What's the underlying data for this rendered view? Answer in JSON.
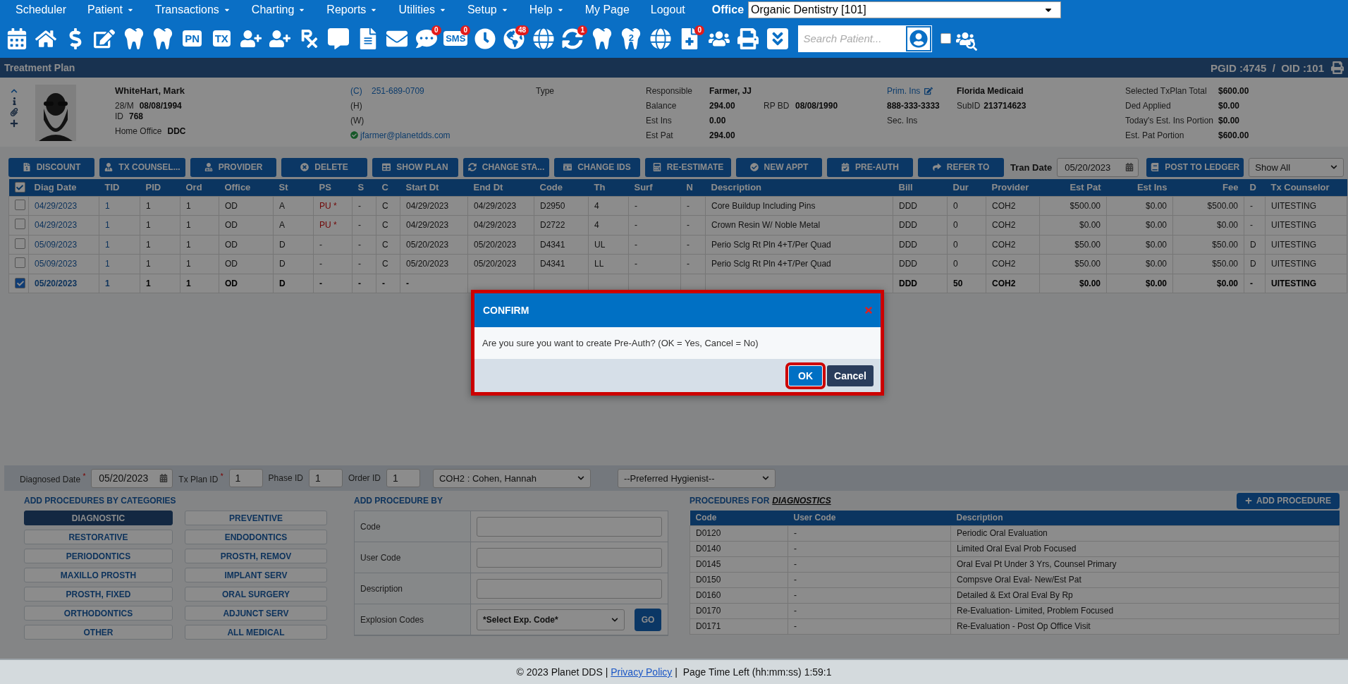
{
  "menu": {
    "items": [
      {
        "label": "Scheduler",
        "has_menu": false
      },
      {
        "label": "Patient",
        "has_menu": true
      },
      {
        "label": "Transactions",
        "has_menu": true
      },
      {
        "label": "Charting",
        "has_menu": true
      },
      {
        "label": "Reports",
        "has_menu": true
      },
      {
        "label": "Utilities",
        "has_menu": true
      },
      {
        "label": "Setup",
        "has_menu": true
      },
      {
        "label": "Help",
        "has_menu": true
      },
      {
        "label": "My Page",
        "has_menu": false
      },
      {
        "label": "Logout",
        "has_menu": false
      }
    ],
    "office_label": "Office",
    "office": "Organic Dentistry [101]"
  },
  "toolbar": {
    "items": [
      {
        "kind": "icon"
      },
      {
        "kind": "icon"
      },
      {
        "kind": "icon"
      },
      {
        "kind": "icon"
      },
      {
        "kind": "icon"
      },
      {
        "kind": "icon"
      },
      {
        "kind": "text",
        "label": "PN"
      },
      {
        "kind": "text",
        "label": "TX"
      },
      {
        "kind": "icon"
      },
      {
        "kind": "icon"
      },
      {
        "kind": "icon"
      },
      {
        "kind": "icon"
      },
      {
        "kind": "icon"
      },
      {
        "kind": "icon"
      },
      {
        "kind": "icon",
        "badge": "0"
      },
      {
        "kind": "text",
        "label": "SMS",
        "badge": "0"
      },
      {
        "kind": "icon"
      },
      {
        "kind": "icon",
        "badge": "48"
      },
      {
        "kind": "icon"
      },
      {
        "kind": "icon",
        "badge": "1"
      },
      {
        "kind": "icon"
      },
      {
        "kind": "icon",
        "label": "2"
      },
      {
        "kind": "icon"
      },
      {
        "kind": "icon",
        "badge": "0"
      },
      {
        "kind": "icon"
      },
      {
        "kind": "icon"
      },
      {
        "kind": "icon"
      }
    ],
    "search": {
      "placeholder": "Search Patient..."
    },
    "filter_checked": false
  },
  "title_bar": {
    "title": "Treatment Plan",
    "ids": "PGID :4745  /  OID :101"
  },
  "patient": {
    "name": "WhiteHart, Mark",
    "age_sex": "28/M",
    "dob": "08/08/1994",
    "id_label": "ID",
    "id": "768",
    "office_label": "Home Office",
    "office": "DDC",
    "phones": [
      {
        "label": "(C)",
        "value": "251-689-0709"
      },
      {
        "label": "(H)"
      },
      {
        "label": "(W)"
      }
    ],
    "email": "jfarmer@planetdds.com",
    "type_label": "Type",
    "account": [
      {
        "label": "Responsible",
        "value": "Farmer, JJ"
      },
      {
        "label": "Balance",
        "value": "294.00",
        "extra_label": "RP BD",
        "extra_value": "08/08/1990"
      },
      {
        "label": "Est Ins",
        "value": "0.00"
      },
      {
        "label": "Est Pat",
        "value": "294.00"
      }
    ],
    "insurance": {
      "primary_label": "Prim. Ins",
      "primary": "Florida Medicaid",
      "phone": "888-333-3333",
      "subid_label": "SubID",
      "subid": "213714623",
      "secondary_label": "Sec. Ins"
    },
    "totals": [
      {
        "label": "Selected TxPlan Total",
        "value": "$600.00"
      },
      {
        "label": "Ded Applied",
        "value": "$0.00"
      },
      {
        "label": "Today's Est. Ins Portion",
        "value": "$0.00"
      },
      {
        "label": "Est. Pat Portion",
        "value": "$600.00"
      }
    ]
  },
  "actions": {
    "buttons": [
      "DISCOUNT",
      "TX COUNSEL...",
      "PROVIDER",
      "DELETE",
      "SHOW PLAN",
      "CHANGE STA...",
      "CHANGE IDS",
      "RE-ESTIMATE",
      "NEW APPT",
      "PRE-AUTH",
      "REFER TO"
    ],
    "tran_date_label": "Tran Date",
    "tran_date": "05/20/2023",
    "post_button": "POST TO LEDGER",
    "filter": "Show All"
  },
  "table": {
    "all_checked": true,
    "columns": [
      {
        "label": "Diag Date",
        "kind": "link"
      },
      {
        "label": "TID",
        "kind": "link"
      },
      {
        "label": "PID",
        "kind": "text"
      },
      {
        "label": "Ord",
        "kind": "text"
      },
      {
        "label": "Office",
        "kind": "text"
      },
      {
        "label": "St",
        "kind": "text"
      },
      {
        "label": "PS",
        "kind": "text"
      },
      {
        "label": "S",
        "kind": "text"
      },
      {
        "label": "C",
        "kind": "text"
      },
      {
        "label": "Start Dt",
        "kind": "text"
      },
      {
        "label": "End Dt",
        "kind": "text"
      },
      {
        "label": "Code",
        "kind": "text"
      },
      {
        "label": "Th",
        "kind": "text"
      },
      {
        "label": "Surf",
        "kind": "text"
      },
      {
        "label": "N",
        "kind": "text"
      },
      {
        "label": "Description",
        "kind": "text"
      },
      {
        "label": "Bill",
        "kind": "text"
      },
      {
        "label": "Dur",
        "kind": "text"
      },
      {
        "label": "Provider",
        "kind": "text"
      },
      {
        "label": "Est Pat",
        "kind": "money"
      },
      {
        "label": "Est Ins",
        "kind": "money"
      },
      {
        "label": "Fee",
        "kind": "money"
      },
      {
        "label": "D",
        "kind": "text"
      },
      {
        "label": "Tx Counselor",
        "kind": "text"
      }
    ],
    "rows": [
      {
        "checked": false,
        "cells": [
          "04/29/2023",
          "1",
          "1",
          "1",
          "OD",
          "A",
          {
            "text": "PU *",
            "kind": "alert"
          },
          "-",
          "C",
          "04/29/2023",
          "04/29/2023",
          "D2950",
          "4",
          "-",
          "-",
          "Core Buildup Including Pins",
          "DDD",
          "0",
          "COH2",
          "$500.00",
          "$0.00",
          "$500.00",
          "-",
          "UITESTING"
        ]
      },
      {
        "checked": false,
        "cells": [
          "04/29/2023",
          "1",
          "1",
          "1",
          "OD",
          "A",
          {
            "text": "PU *",
            "kind": "alert"
          },
          "-",
          "C",
          "04/29/2023",
          "04/29/2023",
          "D2722",
          "4",
          "-",
          "-",
          "Crown Resin W/ Noble Metal",
          "DDD",
          "0",
          "COH2",
          "$0.00",
          "$0.00",
          "$0.00",
          "-",
          "UITESTING"
        ]
      },
      {
        "checked": false,
        "cells": [
          "05/09/2023",
          "1",
          "1",
          "1",
          "OD",
          "D",
          "-",
          "-",
          "C",
          "05/20/2023",
          "05/20/2023",
          "D4341",
          "UL",
          "-",
          "-",
          "Perio Sclg Rt Pln 4+T/Per Quad",
          "DDD",
          "0",
          "COH2",
          "$50.00",
          "$0.00",
          "$50.00",
          "D",
          "UITESTING"
        ]
      },
      {
        "checked": false,
        "cells": [
          "05/09/2023",
          "1",
          "1",
          "1",
          "OD",
          "D",
          "-",
          "-",
          "C",
          "05/20/2023",
          "05/20/2023",
          "D4341",
          "LL",
          "-",
          "-",
          "Perio Sclg Rt Pln 4+T/Per Quad",
          "DDD",
          "0",
          "COH2",
          "$50.00",
          "$0.00",
          "$50.00",
          "D",
          "UITESTING"
        ]
      },
      {
        "checked": true,
        "cells": [
          "05/20/2023",
          "1",
          "1",
          "1",
          "OD",
          "D",
          "-",
          "-",
          "-",
          "-",
          null,
          null,
          null,
          null,
          null,
          null,
          "DDD",
          "50",
          "COH2",
          "$0.00",
          "$0.00",
          "$0.00",
          "-",
          "UITESTING"
        ]
      }
    ]
  },
  "dialog": {
    "title": "CONFIRM",
    "message": "Are you sure you want to create Pre-Auth? (OK = Yes, Cancel = No)",
    "highlighted": true,
    "buttons": [
      {
        "label": "OK",
        "kind": "primary",
        "highlighted": true
      },
      {
        "label": "Cancel",
        "kind": "secondary",
        "highlighted": false
      }
    ]
  },
  "entry": {
    "diagnosed_label": "Diagnosed Date $^{*}$",
    "diagnosed": "05/20/2023",
    "plan_label": "Tx Plan ID $^{*}$",
    "plan": "1",
    "phase_label": "Phase ID",
    "phase": "1",
    "order_label": "Order ID",
    "order": "1",
    "provider": "COH2 : Cohen, Hannah",
    "hygienist": "--Preferred Hygienist--"
  },
  "categories": {
    "title": "ADD PROCEDURES BY CATEGORIES",
    "items": [
      {
        "label": "DIAGNOSTIC",
        "selected": true
      },
      {
        "label": "PREVENTIVE",
        "selected": false
      },
      {
        "label": "RESTORATIVE",
        "selected": false
      },
      {
        "label": "ENDODONTICS",
        "selected": false
      },
      {
        "label": "PERIODONTICS",
        "selected": false
      },
      {
        "label": "PROSTH, REMOV",
        "selected": false
      },
      {
        "label": "MAXILLO PROSTH",
        "selected": false
      },
      {
        "label": "IMPLANT SERV",
        "selected": false
      },
      {
        "label": "PROSTH, FIXED",
        "selected": false
      },
      {
        "label": "ORAL SURGERY",
        "selected": false
      },
      {
        "label": "ORTHODONTICS",
        "selected": false
      },
      {
        "label": "ADJUNCT SERV",
        "selected": false
      },
      {
        "label": "OTHER",
        "selected": false
      },
      {
        "label": "ALL MEDICAL",
        "selected": false
      }
    ]
  },
  "add_by": {
    "title": "ADD PROCEDURE BY",
    "fields": [
      {
        "label": "Code",
        "kind": "input"
      },
      {
        "label": "User Code",
        "kind": "input"
      },
      {
        "label": "Description",
        "kind": "input"
      },
      {
        "label": "Explosion Codes",
        "kind": "select",
        "value": "*Select Exp. Code*",
        "button": "GO"
      }
    ]
  },
  "procedures": {
    "title": "PROCEDURES FOR",
    "category": "DIAGNOSTICS",
    "add_button": "ADD PROCEDURE",
    "columns": [
      "Code",
      "User Code",
      "Description"
    ],
    "rows": [
      [
        "D0120",
        "-",
        "Periodic Oral Evaluation"
      ],
      [
        "D0140",
        "-",
        "Limited Oral Eval Prob Focused"
      ],
      [
        "D0145",
        "-",
        "Oral Eval Pt Under 3 Yrs, Counsel Primary"
      ],
      [
        "D0150",
        "-",
        "Compsve Oral Eval- New/Est Pat"
      ],
      [
        "D0160",
        "-",
        "Detailed & Ext Oral Eval By Rp"
      ],
      [
        "D0170",
        "-",
        "Re-Evaluation- Limited, Problem Focused"
      ],
      [
        "D0171",
        "-",
        "Re-Evaluation - Post Op Office Visit"
      ]
    ]
  },
  "footer": {
    "before": "© 2023 Planet DDS |",
    "link": "Privacy Policy",
    "after": "|  Page Time Left (hh:mm:ss) 1:59:1"
  }
}
